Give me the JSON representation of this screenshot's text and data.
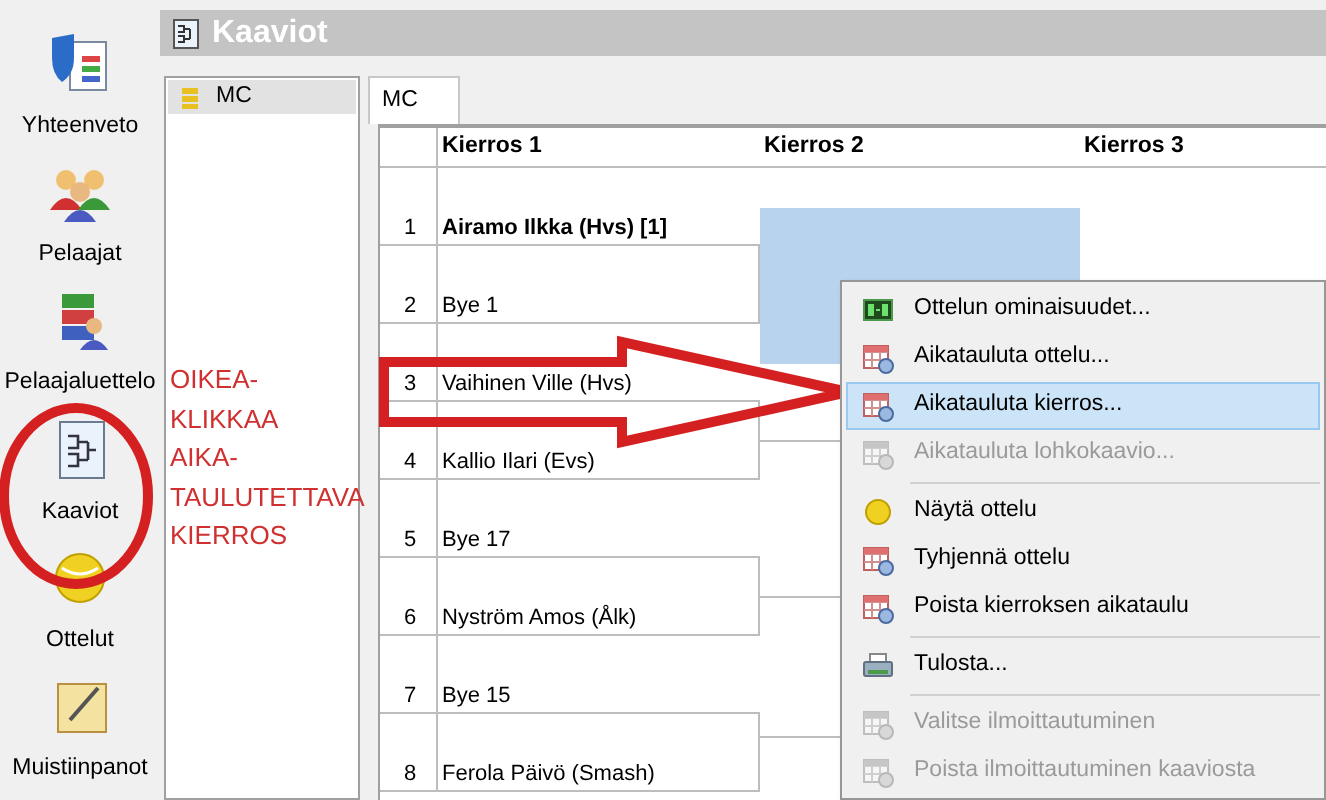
{
  "sidebar": {
    "items": [
      {
        "label": "Yhteenveto"
      },
      {
        "label": "Pelaajat"
      },
      {
        "label": "Pelaajaluettelo"
      },
      {
        "label": "Kaaviot"
      },
      {
        "label": "Ottelut"
      },
      {
        "label": "Muistiinpanot"
      }
    ]
  },
  "title": "Kaaviot",
  "draw_list": {
    "items": [
      {
        "label": "MC",
        "selected": true
      }
    ]
  },
  "annotation": {
    "lines": [
      "OIKEA-",
      "KLIKKAA",
      "AIKA-",
      "TAULUTETTAVA",
      "KIERROS"
    ]
  },
  "tabs": [
    {
      "label": "MC",
      "selected": true
    }
  ],
  "bracket": {
    "columns": [
      "Kierros 1",
      "Kierros 2",
      "Kierros 3"
    ],
    "players": [
      {
        "number": "1",
        "name": "Airamo Ilkka (Hvs) [1]",
        "seeded": true
      },
      {
        "number": "2",
        "name": "Bye 1",
        "seeded": false
      },
      {
        "number": "3",
        "name": "Vaihinen Ville (Hvs)",
        "seeded": false
      },
      {
        "number": "4",
        "name": "Kallio Ilari (Evs)",
        "seeded": false
      },
      {
        "number": "5",
        "name": "Bye 17",
        "seeded": false
      },
      {
        "number": "6",
        "name": "Nyström Amos (Ålk)",
        "seeded": false
      },
      {
        "number": "7",
        "name": "Bye 15",
        "seeded": false
      },
      {
        "number": "8",
        "name": "Ferola Päivö (Smash)",
        "seeded": false
      }
    ],
    "round_2": [
      {
        "selected": true
      },
      {
        "selected": false
      },
      {
        "selected": false
      },
      {
        "selected": false
      }
    ]
  },
  "context_menu": {
    "items": [
      {
        "kind": "item",
        "label": "Ottelun ominaisuudet...",
        "disabled": false,
        "selected": false
      },
      {
        "kind": "item",
        "label": "Aikatauluta ottelu...",
        "disabled": false,
        "selected": false
      },
      {
        "kind": "item",
        "label": "Aikatauluta kierros...",
        "disabled": false,
        "selected": true
      },
      {
        "kind": "item",
        "label": "Aikatauluta lohkokaavio...",
        "disabled": true,
        "selected": false
      },
      {
        "kind": "separator"
      },
      {
        "kind": "item",
        "label": "Näytä ottelu",
        "disabled": false,
        "selected": false
      },
      {
        "kind": "item",
        "label": "Tyhjennä ottelu",
        "disabled": false,
        "selected": false
      },
      {
        "kind": "item",
        "label": "Poista kierroksen aikataulu",
        "disabled": false,
        "selected": false
      },
      {
        "kind": "separator"
      },
      {
        "kind": "item",
        "label": "Tulosta...",
        "disabled": false,
        "selected": false
      },
      {
        "kind": "separator"
      },
      {
        "kind": "item",
        "label": "Valitse ilmoittautuminen",
        "disabled": true,
        "selected": false
      },
      {
        "kind": "item",
        "label": "Poista ilmoittautuminen kaaviosta",
        "disabled": true,
        "selected": false
      }
    ]
  }
}
